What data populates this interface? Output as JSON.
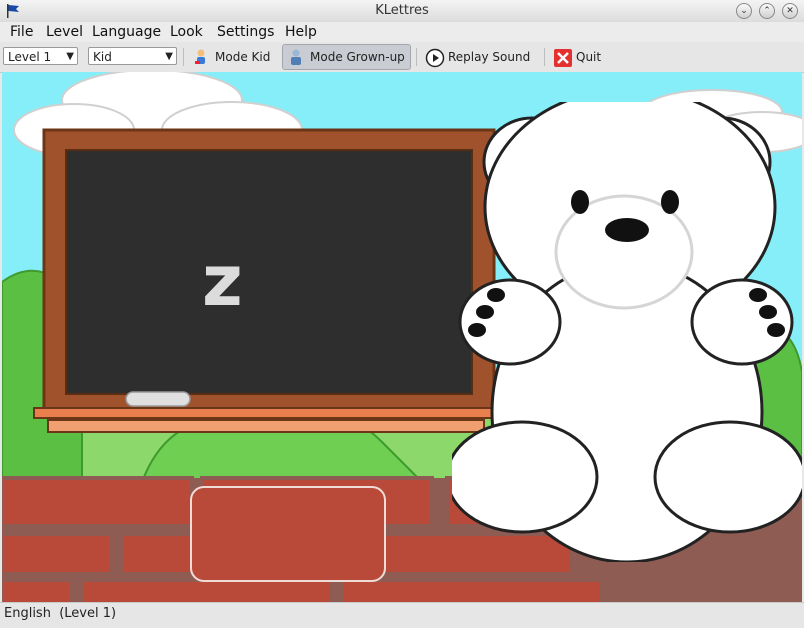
{
  "window": {
    "title": "KLettres"
  },
  "menu": [
    "File",
    "Level",
    "Language",
    "Look",
    "Settings",
    "Help"
  ],
  "toolbar": {
    "level_combo": "Level 1",
    "look_combo": "Kid",
    "mode_kid": "Mode Kid",
    "mode_grownup": "Mode Grown-up",
    "replay_sound": "Replay Sound",
    "quit": "Quit"
  },
  "board": {
    "letter": "z"
  },
  "status": {
    "language": "English",
    "level": "(Level 1)"
  },
  "colors": {
    "sky": "#86eef8",
    "board": "#2e2e2e",
    "frame": "#a0522d",
    "brick": "#b94a39"
  }
}
